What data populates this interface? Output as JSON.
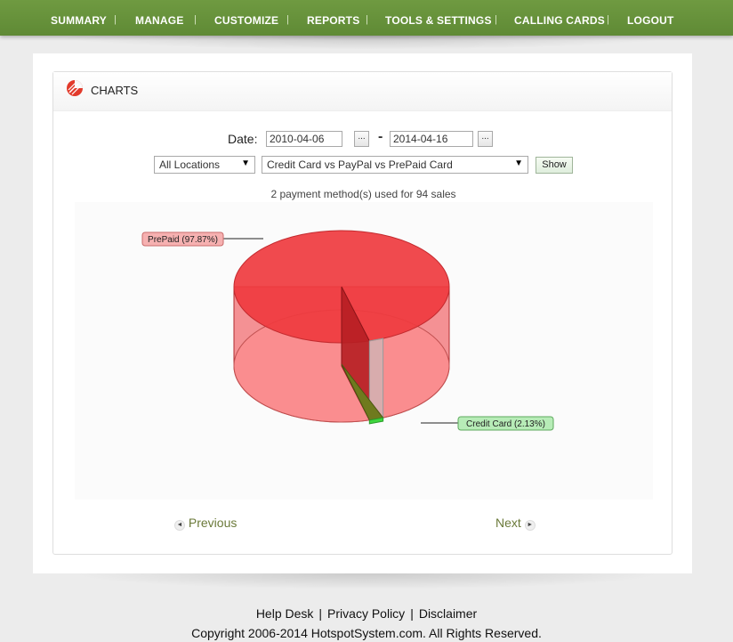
{
  "nav": {
    "items": [
      "Summary",
      "Manage",
      "Customize",
      "Reports",
      "Tools & Settings",
      "Calling Cards",
      "Logout"
    ],
    "separator": "|"
  },
  "panel": {
    "title": "CHARTS",
    "date_label": "Date:",
    "date_from": "2010-04-06",
    "date_to": "2014-04-16",
    "date_button": "...",
    "date_dash": "-",
    "location_select": "All Locations",
    "report_select": "Credit Card vs PayPal vs PrePaid Card",
    "show_button": "Show",
    "summary": "2 payment method(s) used for 94 sales"
  },
  "pager": {
    "previous": "Previous",
    "next": "Next"
  },
  "footer": {
    "links": [
      "Help Desk",
      "Privacy Policy",
      "Disclaimer"
    ],
    "copyright": "Copyright 2006-2014 HotspotSystem.com. All Rights Reserved."
  },
  "colors": {
    "nav_green": "#6a9440",
    "prepaid": "#ef3b3f",
    "credit_card": "#3fd63f",
    "pager_text": "#6b7a3a"
  },
  "chart_data": {
    "type": "pie",
    "style": "3d",
    "labels": [
      "PrePaid",
      "Credit Card"
    ],
    "values": [
      97.87,
      2.13
    ],
    "label_texts": [
      "PrePaid (97.87%)",
      "Credit Card (2.13%)"
    ],
    "colors": [
      "#ef3b3f",
      "#3fd63f"
    ],
    "title": "",
    "legend": "none"
  }
}
